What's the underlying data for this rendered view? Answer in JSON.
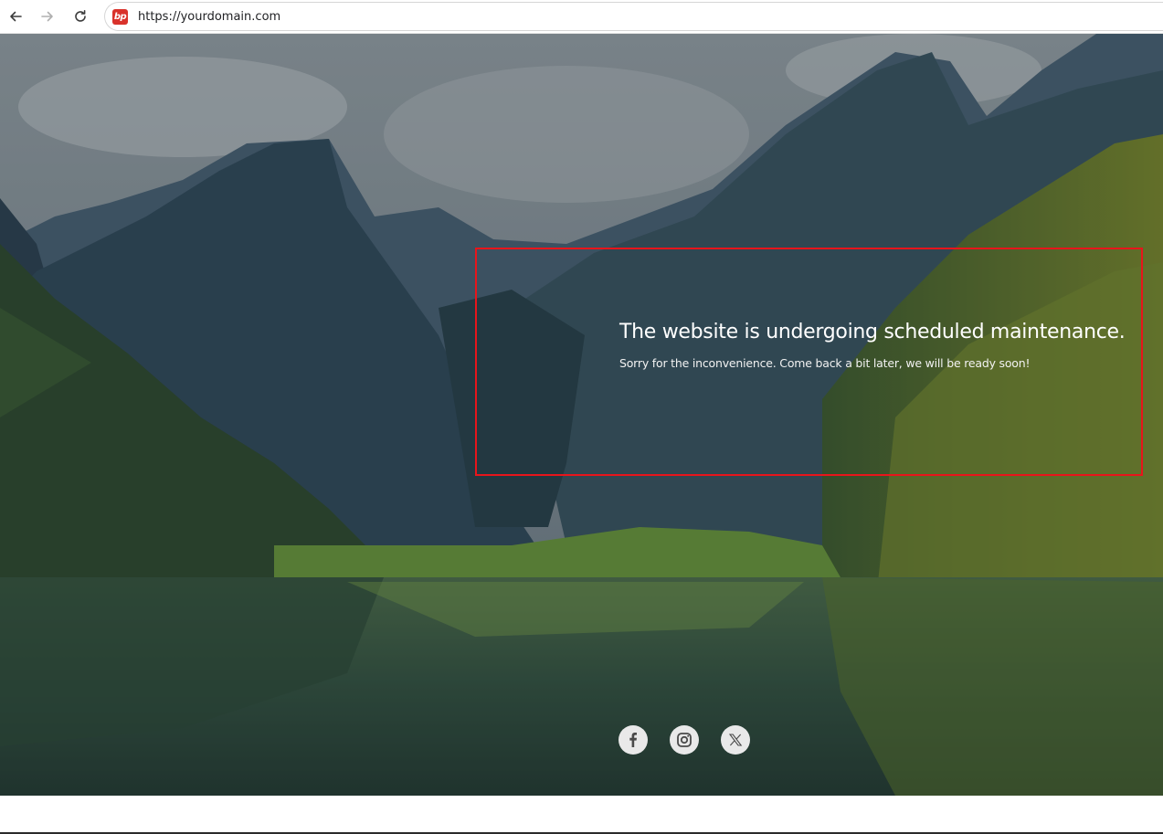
{
  "browser": {
    "url": "https://yourdomain.com",
    "favicon_text": "bp",
    "back_icon": "arrow-left-icon",
    "forward_icon": "arrow-right-icon",
    "reload_icon": "reload-icon"
  },
  "page": {
    "heading": "The website is undergoing scheduled maintenance.",
    "subtext": "Sorry for the inconvenience. Come back a bit later, we will be ready soon!"
  },
  "social": [
    {
      "name": "facebook",
      "icon": "facebook-icon"
    },
    {
      "name": "instagram",
      "icon": "instagram-icon"
    },
    {
      "name": "x",
      "icon": "x-icon"
    }
  ],
  "colors": {
    "highlight": "#e8151b",
    "social_bg": "#e9e9e9",
    "social_glyph": "#4a4a4a",
    "favicon": "#d9322b"
  }
}
